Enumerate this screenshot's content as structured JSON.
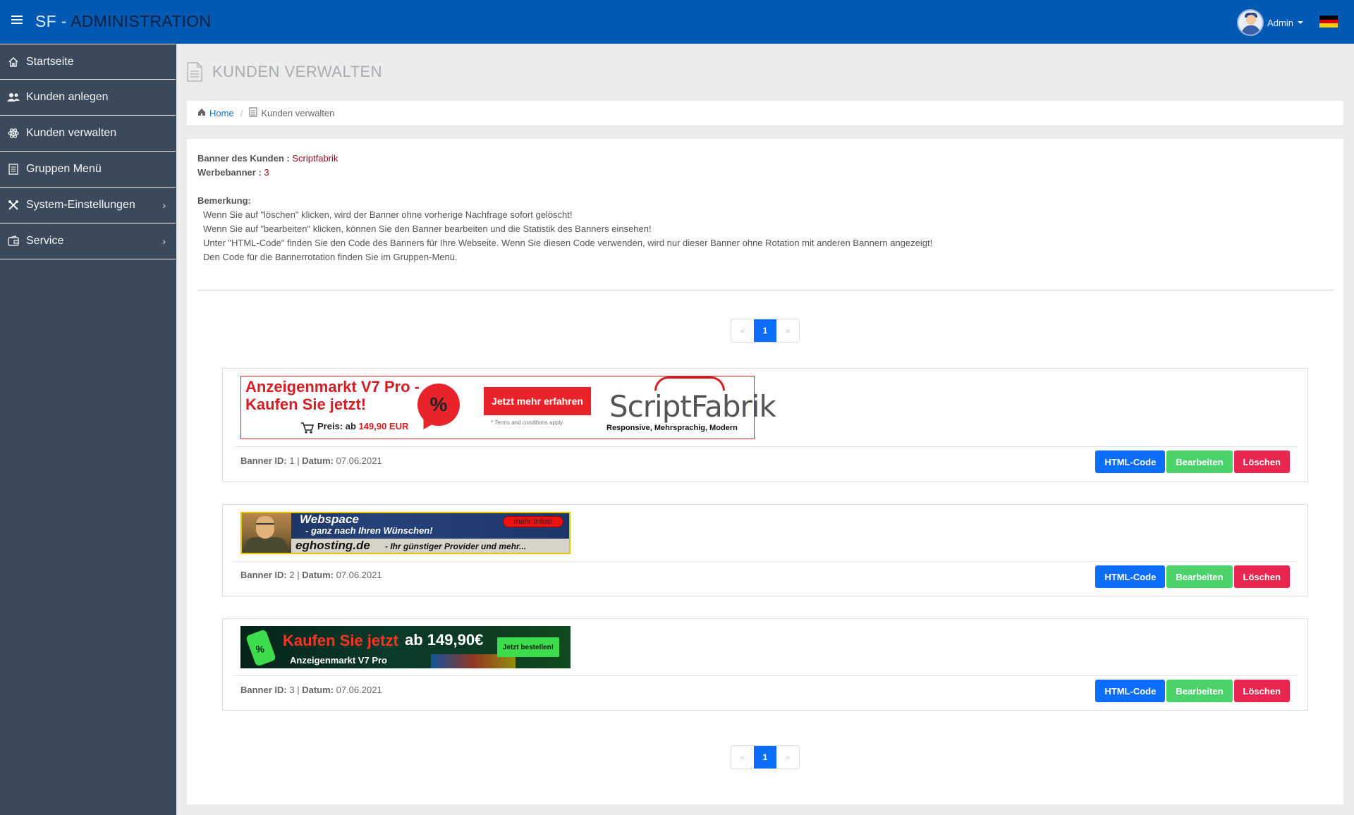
{
  "header": {
    "brand_prefix": "SF - ",
    "brand_main": "ADMINISTRATION",
    "user_name": "Admin"
  },
  "sidebar": {
    "items": [
      {
        "label": "Startseite",
        "icon": "home-icon"
      },
      {
        "label": "Kunden anlegen",
        "icon": "users-icon"
      },
      {
        "label": "Kunden verwalten",
        "icon": "atom-icon"
      },
      {
        "label": "Gruppen Menü",
        "icon": "list-icon"
      },
      {
        "label": "System-Einstellungen",
        "icon": "tools-icon",
        "chevron": "›"
      },
      {
        "label": "Service",
        "icon": "wallet-icon",
        "chevron": "›"
      }
    ]
  },
  "page": {
    "title": "KUNDEN VERWALTEN",
    "breadcrumb": {
      "home": "Home",
      "current": "Kunden verwalten"
    }
  },
  "info": {
    "banner_label": "Banner des Kunden :",
    "banner_customer": "Scriptfabrik",
    "count_label": "Werbebanner :",
    "count_value": "3",
    "remark_label": "Bemerkung:",
    "remarks": [
      "Wenn Sie auf \"löschen\" klicken, wird der Banner ohne vorherige Nachfrage sofort gelöscht!",
      "Wenn Sie auf \"bearbeiten\" klicken, können Sie den Banner bearbeiten und die Statistik des Banners einsehen!",
      "Unter \"HTML-Code\" finden Sie den Code des Banners für Ihre Webseite. Wenn Sie diesen Code verwenden, wird nur dieser Banner ohne Rotation mit anderen Bannern angezeigt!",
      "Den Code für die Bannerrotation finden Sie im Gruppen-Menü."
    ]
  },
  "pagination": {
    "prev": "«",
    "page": "1",
    "next": "»"
  },
  "banners": [
    {
      "id_label": "Banner ID:",
      "id": "1",
      "date_label": "Datum:",
      "date": "07.06.2021",
      "art": {
        "title1": "Anzeigenmarkt V7 Pro -",
        "title2": "Kaufen Sie jetzt!",
        "price_label": "Preis: ab",
        "price": "149,90 EUR",
        "percent": "%",
        "cta": "Jetzt mehr erfahren",
        "terms": "* Terms and conditions apply",
        "logo": "ScriptFabrik",
        "tagline": "Responsive, Mehrsprachig, Modern"
      }
    },
    {
      "id_label": "Banner ID:",
      "id": "2",
      "date_label": "Datum:",
      "date": "07.06.2021",
      "art": {
        "title1": "Webspace",
        "title2": "- ganz nach Ihren Wünschen!",
        "more": "mehr Infos!",
        "domain": "eghosting.de",
        "slogan": "- Ihr günstiger Provider und mehr..."
      }
    },
    {
      "id_label": "Banner ID:",
      "id": "3",
      "date_label": "Datum:",
      "date": "07.06.2021",
      "art": {
        "title1": "Kaufen Sie jetzt",
        "title2": "ab 149,90€",
        "product": "Anzeigenmarkt V7 Pro",
        "cta": "Jetzt bestellen!",
        "percent": "%"
      }
    }
  ],
  "actions": {
    "html": "HTML-Code",
    "edit": "Bearbeiten",
    "delete": "Löschen"
  },
  "colors": {
    "topbar": "#0059b3",
    "sidebar": "#3a4a5a",
    "primary": "#0d6efd",
    "success": "#4bd26a",
    "danger": "#e8264f",
    "accent_red": "#8a0d1b"
  }
}
